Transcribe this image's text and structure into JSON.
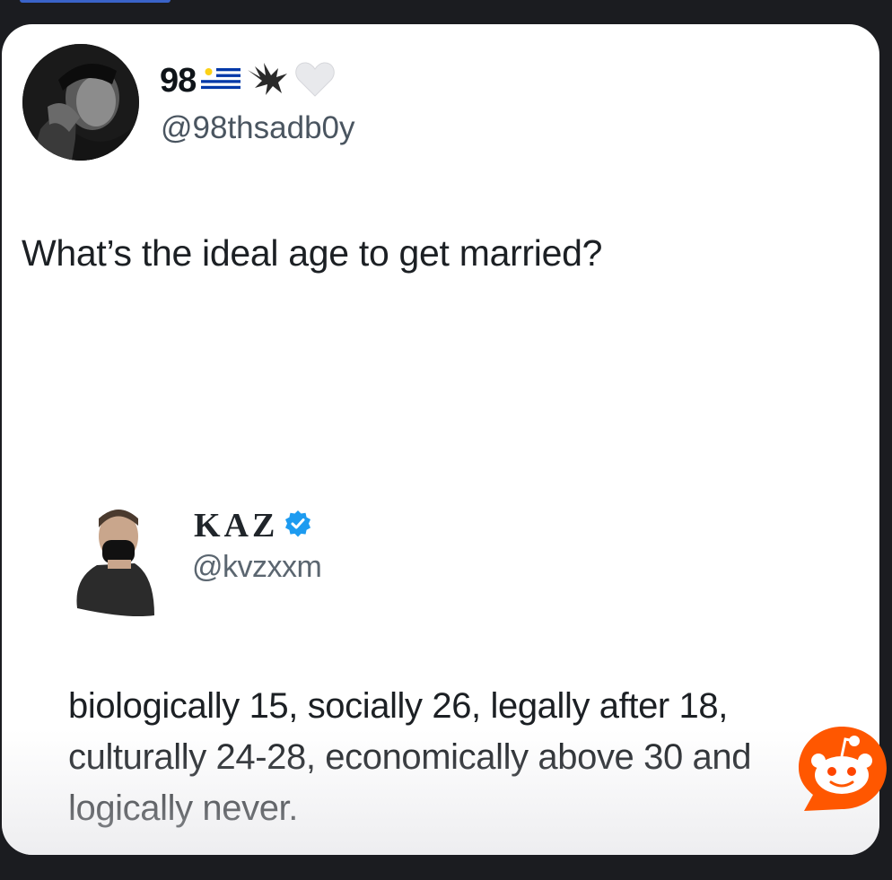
{
  "tweet": {
    "display_name": "98",
    "handle": "@98thsadb0y",
    "text": "What’s the ideal age to get married?",
    "name_icons": [
      "uruguay-flag-icon",
      "eagle-icon",
      "white-heart-icon"
    ]
  },
  "reply": {
    "display_name": "KAZ",
    "handle": "@kvzxxm",
    "verified": true,
    "lines": [
      "biologically 15, socially 26, legally after 18,",
      "culturally 24-28, economically above 30 and",
      "logically never."
    ]
  },
  "colors": {
    "background": "#1b1c20",
    "card": "#ffffff",
    "verified": "#1d9bf0",
    "reddit": "#ff5700"
  }
}
